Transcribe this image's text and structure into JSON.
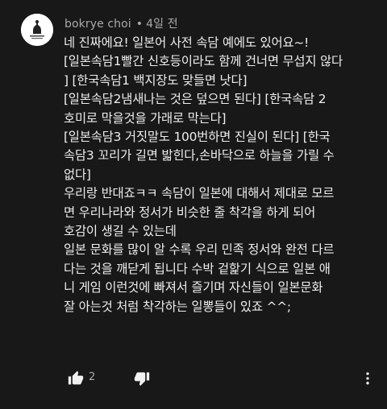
{
  "comment": {
    "author": "bokrye choi",
    "separator": "•",
    "time": "4일 전",
    "lines": [
      "네 진짜에요! 일본어 사전 속담 예에도 있어요~!",
      "[일본속담1빨간 신호등이라도 함께 건너면 무섭지 않다",
      "] [한국속담1 백지장도 맞들면 낫다]",
      "[일본속담2냄새나는 것은 덮으면 된다] [한국속담 2",
      "호미로 막을것을 가래로 막는다]",
      "[일본속담3 거짓말도 100번하면 진실이 된다] [한국",
      "속담3 꼬리가 길면 밟힌다,손바닥으로 하늘을 가릴 수",
      "없다]",
      "우리랑 반대죠ㅋㅋ 속담이 일본에 대해서 제대로 모르",
      "면 우리나라와 정서가 비슷한 줄 착각을 하게 되어",
      "호감이 생길 수 있는데",
      "일본 문화를 많이 알 수록 우리 민족 정서와 완전 다르",
      "다는 것을 깨닫게 됩니다 수박 겉핥기 식으로 일본 애",
      "니 게임 이런것에 빠져서 즐기며 자신들이 일본문화",
      "잘 아는것 처럼 착각하는 일뽕들이 있죠 ^^;"
    ],
    "like_count": "2"
  },
  "icons": {
    "like": "thumbs-up-icon",
    "dislike": "thumbs-down-icon",
    "more": "more-vertical-icon",
    "avatar": "profile-avatar"
  },
  "colors": {
    "background": "#181818",
    "text": "#eeeeee",
    "meta": "#aaaaaa"
  }
}
